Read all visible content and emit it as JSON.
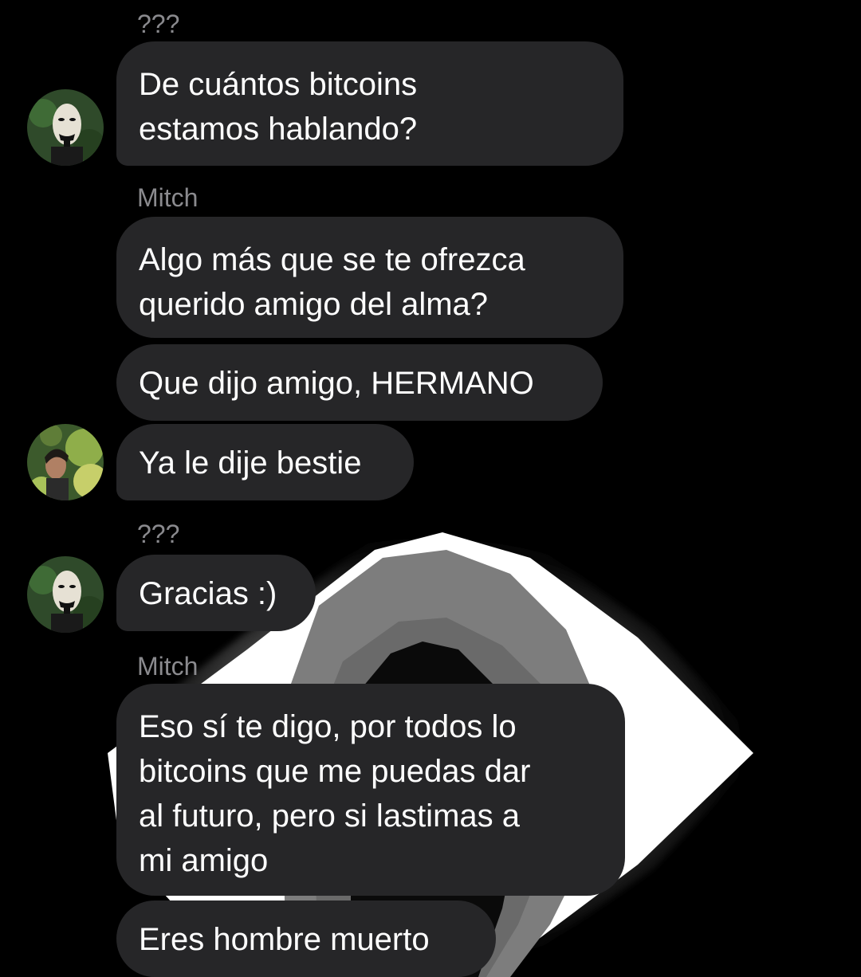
{
  "chat": {
    "messages": [
      {
        "sender": "???",
        "text": "De cuántos bitcoins\nestamos hablando?"
      },
      {
        "sender": "Mitch",
        "text": "Algo más que se te ofrezca\nquerido amigo del alma?"
      },
      {
        "text": "Que dijo amigo, HERMANO"
      },
      {
        "text": "Ya le dije bestie"
      },
      {
        "sender": "???",
        "text": "Gracias :)"
      },
      {
        "sender": "Mitch",
        "text": "Eso sí te digo, por todos lo\nbitcoins que me puedas dar\nal futuro, pero si lastimas a\nmi amigo"
      },
      {
        "text": "Eres hombre muerto"
      }
    ]
  },
  "avatars": [
    {
      "icon": "mask-avatar-icon"
    },
    {
      "icon": "person-leaves-avatar-icon"
    },
    {
      "icon": "mask-avatar-icon"
    }
  ],
  "colors": {
    "background": "#000000",
    "bubble": "#262628",
    "bubble_text": "#ffffff",
    "sender_text": "#8a8a8e"
  }
}
